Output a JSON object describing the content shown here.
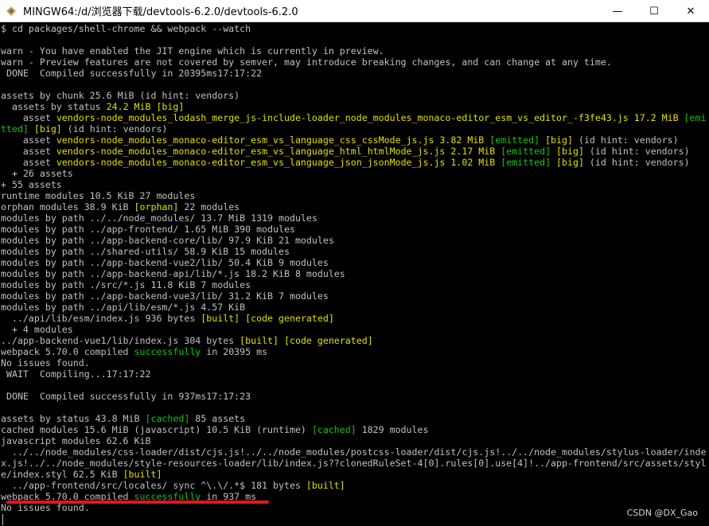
{
  "window": {
    "title": "MINGW64:/d/浏览器下载/devtools-6.2.0/devtools-6.2.0",
    "controls": {
      "minimize": "—",
      "maximize": "☐",
      "close": "✕"
    }
  },
  "terminal": {
    "lines": [
      [
        {
          "t": "$ cd packages/shell-chrome && webpack --watch",
          "c": "default"
        }
      ],
      [
        {
          "t": "",
          "c": "default"
        }
      ],
      [
        {
          "t": "warn - You have enabled the JIT engine which is currently in preview.",
          "c": "default"
        }
      ],
      [
        {
          "t": "warn - Preview features are not covered by semver, may introduce breaking changes, and can change at any time.",
          "c": "default"
        }
      ],
      [
        {
          "t": " DONE  Compiled successfully in 20395ms17:17:22",
          "c": "default"
        }
      ],
      [
        {
          "t": "",
          "c": "default"
        }
      ],
      [
        {
          "t": "assets by chunk 25.6 MiB (id hint: vendors)",
          "c": "default"
        }
      ],
      [
        {
          "t": "  assets by status ",
          "c": "default"
        },
        {
          "t": "24.2 MiB",
          "c": "yellow"
        },
        {
          "t": " [big]",
          "c": "yellow"
        }
      ],
      [
        {
          "t": "    asset ",
          "c": "default"
        },
        {
          "t": "vendors-node_modules_lodash_merge_js-include-loader_node_modules_monaco-editor_esm_vs_editor_-f3fe43.js 17.2 MiB",
          "c": "yellow"
        },
        {
          "t": " [emi",
          "c": "green"
        }
      ],
      [
        {
          "t": "tted]",
          "c": "green"
        },
        {
          "t": " [big]",
          "c": "yellow"
        },
        {
          "t": " (id hint: vendors)",
          "c": "default"
        }
      ],
      [
        {
          "t": "    asset ",
          "c": "default"
        },
        {
          "t": "vendors-node_modules_monaco-editor_esm_vs_language_css_cssMode_js.js 3.82 MiB",
          "c": "yellow"
        },
        {
          "t": " [emitted]",
          "c": "green"
        },
        {
          "t": " [big]",
          "c": "yellow"
        },
        {
          "t": " (id hint: vendors)",
          "c": "default"
        }
      ],
      [
        {
          "t": "    asset ",
          "c": "default"
        },
        {
          "t": "vendors-node_modules_monaco-editor_esm_vs_language_html_htmlMode_js.js 2.17 MiB",
          "c": "yellow"
        },
        {
          "t": " [emitted]",
          "c": "green"
        },
        {
          "t": " [big]",
          "c": "yellow"
        },
        {
          "t": " (id hint: vendors)",
          "c": "default"
        }
      ],
      [
        {
          "t": "    asset ",
          "c": "default"
        },
        {
          "t": "vendors-node_modules_monaco-editor_esm_vs_language_json_jsonMode_js.js 1.02 MiB",
          "c": "yellow"
        },
        {
          "t": " [emitted]",
          "c": "green"
        },
        {
          "t": " [big]",
          "c": "yellow"
        },
        {
          "t": " (id hint: vendors)",
          "c": "default"
        }
      ],
      [
        {
          "t": "  + 26 assets",
          "c": "default"
        }
      ],
      [
        {
          "t": "+ 55 assets",
          "c": "default"
        }
      ],
      [
        {
          "t": "runtime modules 10.5 KiB 27 modules",
          "c": "default"
        }
      ],
      [
        {
          "t": "orphan modules 38.9 KiB ",
          "c": "default"
        },
        {
          "t": "[orphan]",
          "c": "yellow"
        },
        {
          "t": " 22 modules",
          "c": "default"
        }
      ],
      [
        {
          "t": "modules by path ../../node_modules/ 13.7 MiB 1319 modules",
          "c": "default"
        }
      ],
      [
        {
          "t": "modules by path ../app-frontend/ 1.65 MiB 390 modules",
          "c": "default"
        }
      ],
      [
        {
          "t": "modules by path ../app-backend-core/lib/ 97.9 KiB 21 modules",
          "c": "default"
        }
      ],
      [
        {
          "t": "modules by path ../shared-utils/ 58.9 KiB 15 modules",
          "c": "default"
        }
      ],
      [
        {
          "t": "modules by path ../app-backend-vue2/lib/ 50.4 KiB 9 modules",
          "c": "default"
        }
      ],
      [
        {
          "t": "modules by path ../app-backend-api/lib/*.js 18.2 KiB 8 modules",
          "c": "default"
        }
      ],
      [
        {
          "t": "modules by path ./src/*.js 11.8 KiB 7 modules",
          "c": "default"
        }
      ],
      [
        {
          "t": "modules by path ../app-backend-vue3/lib/ 31.2 KiB 7 modules",
          "c": "default"
        }
      ],
      [
        {
          "t": "modules by path ../api/lib/esm/*.js 4.57 KiB",
          "c": "default"
        }
      ],
      [
        {
          "t": "  ../api/lib/esm/index.js 936 bytes ",
          "c": "default"
        },
        {
          "t": "[built]",
          "c": "yellow"
        },
        {
          "t": " ",
          "c": "default"
        },
        {
          "t": "[code generated]",
          "c": "yellow"
        }
      ],
      [
        {
          "t": "  + 4 modules",
          "c": "default"
        }
      ],
      [
        {
          "t": "../app-backend-vue1/lib/index.js 304 bytes ",
          "c": "default"
        },
        {
          "t": "[built]",
          "c": "yellow"
        },
        {
          "t": " ",
          "c": "default"
        },
        {
          "t": "[code generated]",
          "c": "yellow"
        }
      ],
      [
        {
          "t": "webpack 5.70.0 compiled ",
          "c": "default"
        },
        {
          "t": "successfully",
          "c": "green"
        },
        {
          "t": " in 20395 ms",
          "c": "default"
        }
      ],
      [
        {
          "t": "No issues found.",
          "c": "default"
        }
      ],
      [
        {
          "t": " WAIT  Compiling...17:17:22",
          "c": "default"
        }
      ],
      [
        {
          "t": "",
          "c": "default"
        }
      ],
      [
        {
          "t": " DONE  Compiled successfully in 937ms17:17:23",
          "c": "default"
        }
      ],
      [
        {
          "t": "",
          "c": "default"
        }
      ],
      [
        {
          "t": "assets by status 43.8 MiB ",
          "c": "default"
        },
        {
          "t": "[cached]",
          "c": "green"
        },
        {
          "t": " 85 assets",
          "c": "default"
        }
      ],
      [
        {
          "t": "cached modules 15.6 MiB (javascript) 10.5 KiB (runtime) ",
          "c": "default"
        },
        {
          "t": "[cached]",
          "c": "green"
        },
        {
          "t": " 1829 modules",
          "c": "default"
        }
      ],
      [
        {
          "t": "javascript modules 62.6 KiB",
          "c": "default"
        }
      ],
      [
        {
          "t": "  ../../node_modules/css-loader/dist/cjs.js!../../node_modules/postcss-loader/dist/cjs.js!../../node_modules/stylus-loader/inde",
          "c": "default"
        }
      ],
      [
        {
          "t": "x.js!../../node_modules/style-resources-loader/lib/index.js??clonedRuleSet-4[0].rules[0].use[4]!../app-frontend/src/assets/styl",
          "c": "default"
        }
      ],
      [
        {
          "t": "e/index.styl 62.5 KiB ",
          "c": "default"
        },
        {
          "t": "[built]",
          "c": "yellow"
        }
      ],
      [
        {
          "t": "  ../app-frontend/src/locales/ sync ^\\.\\/.*$ 181 bytes ",
          "c": "default"
        },
        {
          "t": "[built]",
          "c": "yellow"
        }
      ],
      [
        {
          "t": "webpack 5.70.0 compiled ",
          "c": "default"
        },
        {
          "t": "successfully",
          "c": "green"
        },
        {
          "t": " in 937 ms",
          "c": "default"
        }
      ],
      [
        {
          "t": "No issues found.",
          "c": "default"
        }
      ]
    ]
  },
  "watermark": "CSDN @DX_Gao",
  "colors": {
    "background": "#000000",
    "text": "#c0c0c0",
    "green": "#13c410",
    "yellow": "#e0e000",
    "annotation": "#e8131d"
  },
  "icons": {
    "app": "mingw-terminal-icon"
  }
}
